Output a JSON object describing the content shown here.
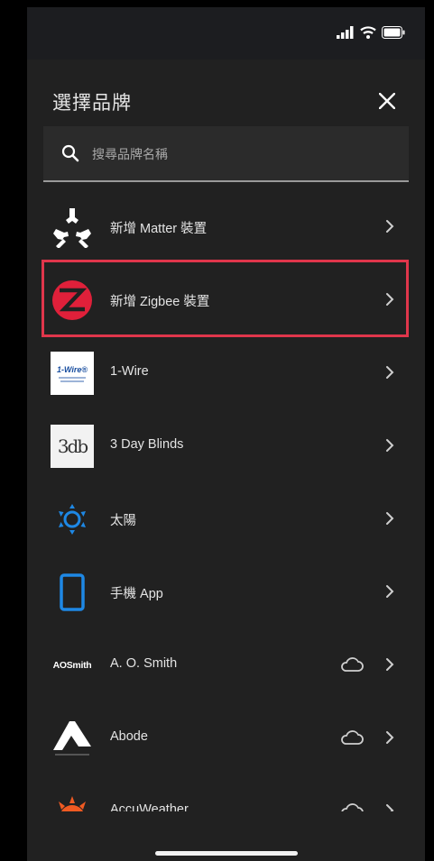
{
  "header": {
    "title": "選擇品牌"
  },
  "search": {
    "placeholder": "搜尋品牌名稱"
  },
  "brands": [
    {
      "label": "新增 Matter 裝置",
      "logo": "matter-logo",
      "cloud": false
    },
    {
      "label": "新增 Zigbee 裝置",
      "logo": "zigbee-logo",
      "cloud": false,
      "highlighted": true
    },
    {
      "label": "1-Wire",
      "logo": "1-wire-logo",
      "logo_text": "1-Wire®",
      "cloud": false
    },
    {
      "label": "3 Day Blinds",
      "logo": "3-day-blinds-logo",
      "logo_text": "3db",
      "cloud": false
    },
    {
      "label": "太陽",
      "logo": "sun-icon",
      "cloud": false
    },
    {
      "label": "手機 App",
      "logo": "phone-icon",
      "cloud": false
    },
    {
      "label": "A. O. Smith",
      "logo": "ao-smith-logo",
      "logo_text": "AOSmith",
      "cloud": true
    },
    {
      "label": "Abode",
      "logo": "abode-logo",
      "cloud": true
    },
    {
      "label": "AccuWeather",
      "logo": "accuweather-logo",
      "cloud": true
    }
  ],
  "colors": {
    "background": "#212121",
    "highlight": "#e0364b",
    "zigbee": "#e0203a",
    "accent_blue": "#1e88e5",
    "accuweather": "#f05a22"
  }
}
